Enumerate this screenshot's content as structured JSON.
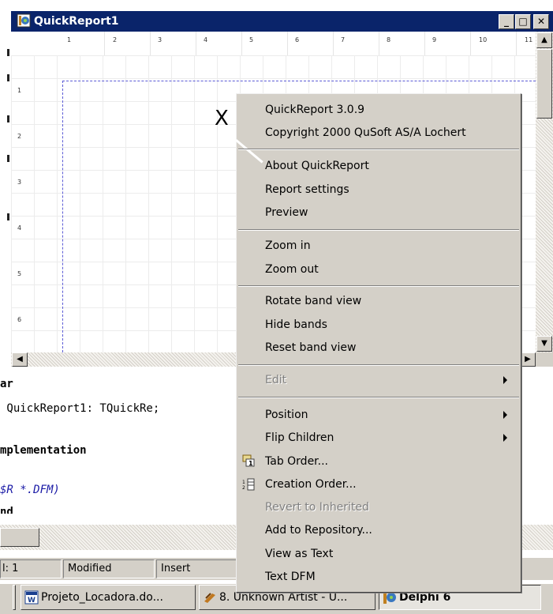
{
  "window": {
    "title": "QuickReport1",
    "minimize_glyph": "_",
    "maximize_glyph": "□",
    "close_glyph": "✕"
  },
  "ruler": {
    "horizontal": [
      "1",
      "2",
      "3",
      "4",
      "5",
      "6",
      "7",
      "8",
      "9",
      "10",
      "11"
    ],
    "vertical": [
      "1",
      "2",
      "3",
      "4",
      "5",
      "6"
    ]
  },
  "cursor_marker": "X",
  "code": {
    "line1": "ar",
    "line2": " QuickReport1: TQuickRe;",
    "line3": "mplementation",
    "line4": "$R *.DFM)",
    "line5": "nd"
  },
  "statusbar": {
    "position": "l:  1",
    "modified": "Modified",
    "mode": "Insert"
  },
  "taskbar": {
    "items": [
      {
        "label": "Projeto_Locadora.do...",
        "icon": "word-document-icon"
      },
      {
        "label": "8. Unknown Artist - U...",
        "icon": "media-player-icon"
      },
      {
        "label": "Delphi 6",
        "icon": "delphi-icon"
      }
    ]
  },
  "context_menu": {
    "version": "QuickReport 3.0.9",
    "copyright": "Copyright 2000 QuSoft AS/A Lochert",
    "about": "About QuickReport",
    "report_settings": "Report settings",
    "preview": "Preview",
    "zoom_in": "Zoom in",
    "zoom_out": "Zoom out",
    "rotate_band_view": "Rotate band view",
    "hide_bands": "Hide bands",
    "reset_band_view": "Reset band view",
    "edit": "Edit",
    "position": "Position",
    "flip_children": "Flip Children",
    "tab_order": "Tab Order...",
    "creation_order": "Creation Order...",
    "revert_to_inherited": "Revert to Inherited",
    "add_to_repository": "Add to Repository...",
    "view_as_text": "View as Text",
    "text_dfm": "Text DFM"
  },
  "colors": {
    "titlebar": "#0a246a",
    "face": "#d4d0c8",
    "page_margin_line": "#5b5bd6",
    "comment_blue": "#1a1aa6"
  }
}
